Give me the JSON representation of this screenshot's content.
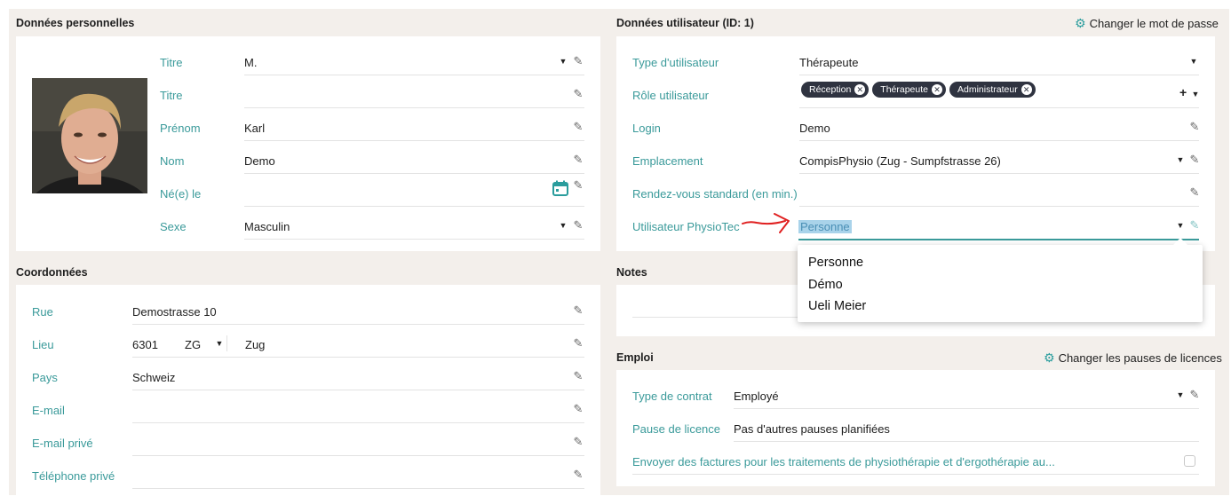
{
  "personal": {
    "title": "Données personnelles",
    "rows": [
      {
        "label": "Titre",
        "value": "M."
      },
      {
        "label": "Titre",
        "value": ""
      },
      {
        "label": "Prénom",
        "value": "Karl"
      },
      {
        "label": "Nom",
        "value": "Demo"
      },
      {
        "label": "Né(e) le",
        "value": ""
      },
      {
        "label": "Sexe",
        "value": "Masculin"
      }
    ]
  },
  "user": {
    "title": "Données utilisateur (ID: 1)",
    "change_password": "Changer le mot de passe",
    "type_label": "Type d'utilisateur",
    "type_value": "Thérapeute",
    "role_label": "Rôle utilisateur",
    "roles": [
      "Réception",
      "Thérapeute",
      "Administrateur"
    ],
    "login_label": "Login",
    "login_value": "Demo",
    "location_label": "Emplacement",
    "location_value": "CompisPhysio (Zug - Sumpfstrasse 26)",
    "appointment_label": "Rendez-vous standard (en min.)",
    "physiotec_label": "Utilisateur PhysioTec",
    "physiotec_value": "Personne",
    "dropdown_options": [
      "Personne",
      "Démo",
      "Ueli Meier"
    ]
  },
  "contact": {
    "title": "Coordonnées",
    "street_label": "Rue",
    "street_value": "Demostrasse 10",
    "place_label": "Lieu",
    "zip": "6301",
    "canton": "ZG",
    "city": "Zug",
    "country_label": "Pays",
    "country_value": "Schweiz",
    "email_label": "E-mail",
    "private_email_label": "E-mail privé",
    "private_phone_label": "Téléphone privé"
  },
  "notes": {
    "title": "Notes"
  },
  "employment": {
    "title": "Emploi",
    "change_pauses": "Changer les pauses de licences",
    "contract_label": "Type de contrat",
    "contract_value": "Employé",
    "pause_label": "Pause de licence",
    "pause_value": "Pas d'autres pauses planifiées",
    "invoice_label": "Envoyer des factures pour les traitements de physiothérapie et d'ergothérapie au..."
  },
  "colors": {
    "accent": "#3a9a9a",
    "background": "#f3efeb",
    "chip": "#2f3340",
    "annotation_arrow": "#e02020"
  },
  "icons": [
    "pencil-icon",
    "caret-down-icon",
    "calendar-icon",
    "gear-icon",
    "plus-icon",
    "close-icon"
  ]
}
